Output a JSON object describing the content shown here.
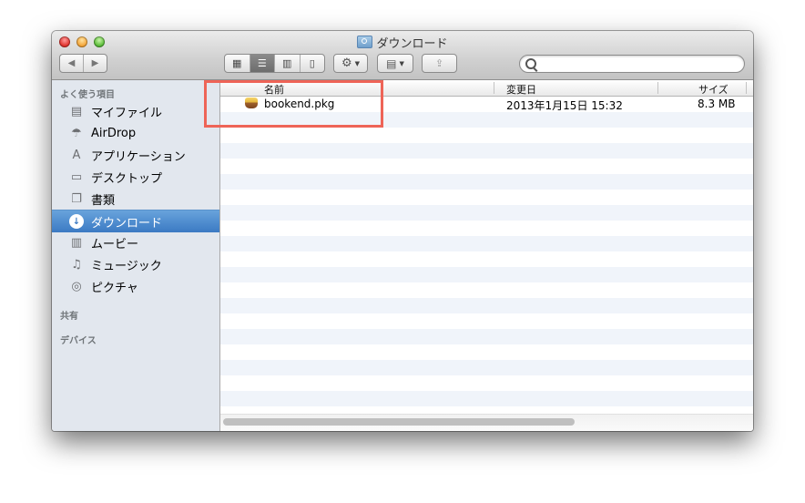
{
  "window": {
    "title": "ダウンロード",
    "title_icon": "downloads-folder-icon"
  },
  "toolbar": {
    "back": "◀",
    "forward": "▶",
    "views": [
      {
        "name": "icon-view",
        "glyph": "▦",
        "active": false
      },
      {
        "name": "list-view",
        "glyph": "☰",
        "active": true
      },
      {
        "name": "column-view",
        "glyph": "▥",
        "active": false
      },
      {
        "name": "coverflow-view",
        "glyph": "▯",
        "active": false
      }
    ],
    "action_glyph": "⚙",
    "arrange_glyph": "▤",
    "share_glyph": "⇪",
    "caret": "▼",
    "search": {
      "value": "",
      "placeholder": ""
    }
  },
  "sidebar": {
    "favorites_header": "よく使う項目",
    "items": [
      {
        "label": "マイファイル",
        "icon": "all-my-files-icon",
        "glyph": "▤",
        "selected": false
      },
      {
        "label": "AirDrop",
        "icon": "airdrop-icon",
        "glyph": "☂",
        "selected": false
      },
      {
        "label": "アプリケーション",
        "icon": "applications-icon",
        "glyph": "A",
        "selected": false
      },
      {
        "label": "デスクトップ",
        "icon": "desktop-icon",
        "glyph": "▭",
        "selected": false
      },
      {
        "label": "書類",
        "icon": "documents-icon",
        "glyph": "❐",
        "selected": false
      },
      {
        "label": "ダウンロード",
        "icon": "downloads-icon",
        "glyph": "↓",
        "selected": true
      },
      {
        "label": "ムービー",
        "icon": "movies-icon",
        "glyph": "▥",
        "selected": false
      },
      {
        "label": "ミュージック",
        "icon": "music-icon",
        "glyph": "♫",
        "selected": false
      },
      {
        "label": "ピクチャ",
        "icon": "pictures-icon",
        "glyph": "◎",
        "selected": false
      }
    ],
    "shared_header": "共有",
    "devices_header": "デバイス"
  },
  "list": {
    "columns": {
      "name": "名前",
      "date": "変更日",
      "size": "サイズ"
    },
    "files": [
      {
        "name": "bookend.pkg",
        "date": "2013年1月15日 15:32",
        "size": "8.3 MB",
        "icon": "package-icon"
      }
    ],
    "empty_rows": 19
  },
  "annotation": {
    "color": "#ee6457"
  },
  "colors": {
    "selection": "#3b7ac3",
    "stripe": "#f0f4fa"
  }
}
